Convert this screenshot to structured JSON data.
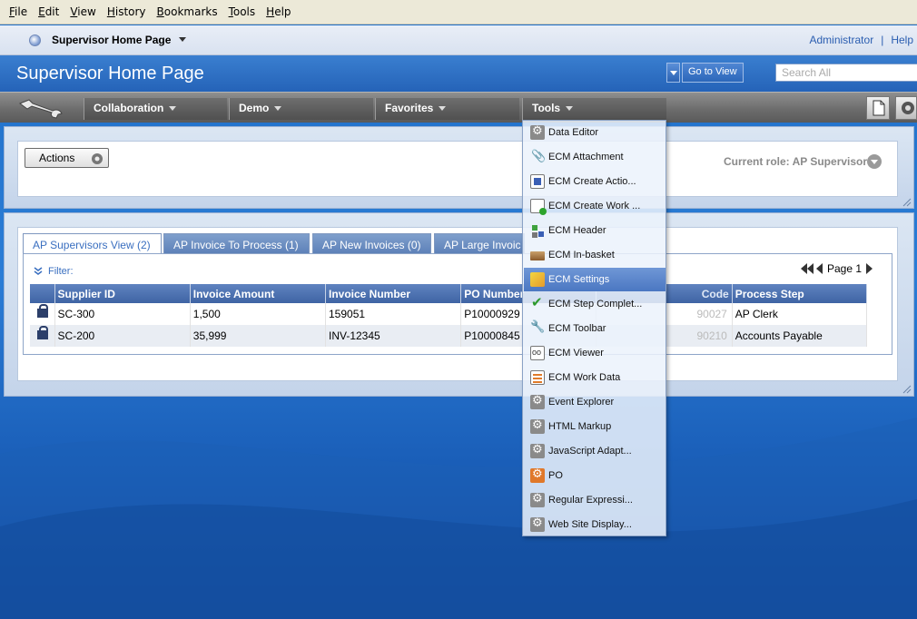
{
  "menubar": [
    "File",
    "Edit",
    "View",
    "History",
    "Bookmarks",
    "Tools",
    "Help"
  ],
  "tab": {
    "title": "Supervisor Home Page"
  },
  "user_links": {
    "admin": "Administrator",
    "sep": "|",
    "help": "Help"
  },
  "header": {
    "page_title": "Supervisor Home Page",
    "goto_label": "Go to View",
    "search_placeholder": "Search All"
  },
  "nav": [
    {
      "label": "Collaboration"
    },
    {
      "label": "Demo"
    },
    {
      "label": "Favorites"
    },
    {
      "label": "Tools"
    }
  ],
  "actions_portlet": {
    "actions_label": "Actions",
    "current_role": "Current role: AP Supervisor"
  },
  "view_tabs": [
    {
      "label": "AP Supervisors View (2)",
      "active": true
    },
    {
      "label": "AP Invoice To Process (1)",
      "active": false
    },
    {
      "label": "AP New Invoices (0)",
      "active": false
    },
    {
      "label": "AP Large Invoic",
      "active": false
    }
  ],
  "filter_label": "Filter:",
  "pager_label": "Page 1",
  "table": {
    "columns": [
      "Supplier ID",
      "Invoice Amount",
      "Invoice Number",
      "PO Number",
      "",
      "Process Step"
    ],
    "hidden_header_fragment": "Code",
    "rows": [
      [
        "SC-300",
        "1,500",
        "159051",
        "P10000929",
        "90027",
        "AP Clerk"
      ],
      [
        "SC-200",
        "35,999",
        "INV-12345",
        "P10000845",
        "90210",
        "Accounts Payable"
      ]
    ]
  },
  "tools_menu": [
    {
      "label": "Data Editor",
      "icon": "gear-icon"
    },
    {
      "label": "ECM Attachment",
      "icon": "paperclip-icon"
    },
    {
      "label": "ECM Create Actio...",
      "icon": "document-icon"
    },
    {
      "label": "ECM Create Work ...",
      "icon": "document-add-icon"
    },
    {
      "label": "ECM Header",
      "icon": "tree-icon"
    },
    {
      "label": "ECM In-basket",
      "icon": "inbox-icon"
    },
    {
      "label": "ECM Settings",
      "icon": "settings-icon",
      "highlighted": true
    },
    {
      "label": "ECM Step Complet...",
      "icon": "check-icon"
    },
    {
      "label": "ECM Toolbar",
      "icon": "wrench-icon"
    },
    {
      "label": "ECM Viewer",
      "icon": "viewer-icon"
    },
    {
      "label": "ECM Work Data",
      "icon": "data-icon"
    },
    {
      "label": "Event Explorer",
      "icon": "gear-icon"
    },
    {
      "label": "HTML Markup",
      "icon": "gear-icon"
    },
    {
      "label": "JavaScript Adapt...",
      "icon": "gear-icon"
    },
    {
      "label": "PO",
      "icon": "gear-orange-icon"
    },
    {
      "label": "Regular Expressi...",
      "icon": "gear-icon"
    },
    {
      "label": "Web Site Display...",
      "icon": "gear-icon"
    }
  ]
}
